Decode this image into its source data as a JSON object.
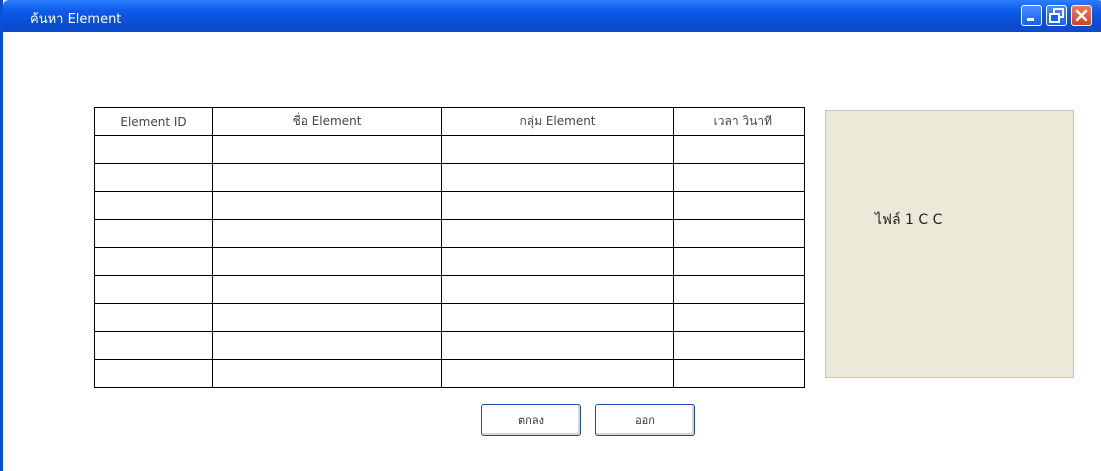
{
  "window": {
    "title": "ค้นหา Element",
    "controls": [
      "minimize-icon",
      "restore-icon",
      "close-icon"
    ],
    "titlebar_color": "#0a4ed6"
  },
  "table": {
    "columns": [
      "Element ID",
      "ชื่อ Element",
      "กลุ่ม Element",
      "เวลา วินาที"
    ],
    "empty_rows": 9
  },
  "side_panel": {
    "label": "ไฟล์ 1 C C"
  },
  "buttons": {
    "ok": "ตกลง",
    "cancel": "ออก"
  }
}
